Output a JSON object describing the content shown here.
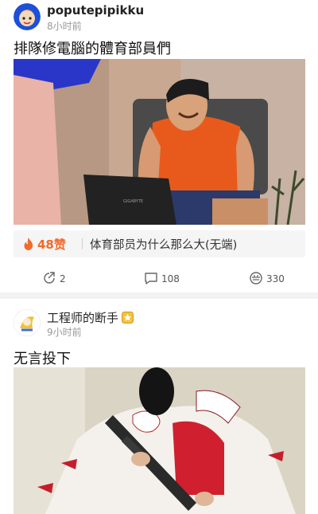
{
  "posts": [
    {
      "username": "poputepipikku",
      "time": "8小时前",
      "title": "排隊修電腦的體育部員們",
      "hot_comment": {
        "likes": "48赞",
        "text": "体育部员为什么那么大(无端)"
      },
      "actions": {
        "share_count": "2",
        "comment_count": "108",
        "like_count": "330"
      },
      "image_text": "GIGABYTE"
    },
    {
      "username": "工程师的断手",
      "time": "9小时前",
      "title": "无言投下"
    }
  ],
  "colors": {
    "accent": "#f26a2a",
    "muted": "#999999",
    "divider": "#f2f2f2"
  },
  "icons": [
    "avatar-blue-cartoon",
    "fire-icon",
    "share-icon",
    "comment-icon",
    "like-icon",
    "badge-icon"
  ]
}
